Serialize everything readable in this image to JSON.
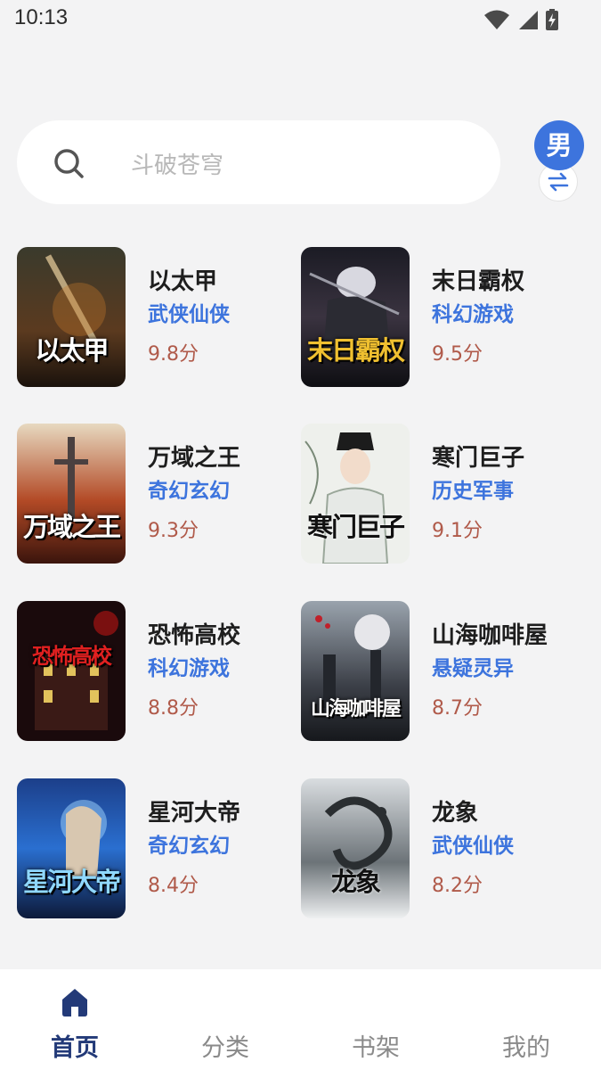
{
  "status": {
    "time": "10:13"
  },
  "search": {
    "placeholder": "斗破苍穹"
  },
  "gender": {
    "label": "男"
  },
  "books": [
    {
      "title": "以太甲",
      "genre": "武侠仙侠",
      "score": "9.8分",
      "cover_text": "以太甲"
    },
    {
      "title": "末日霸权",
      "genre": "科幻游戏",
      "score": "9.5分",
      "cover_text": "末日霸权"
    },
    {
      "title": "万域之王",
      "genre": "奇幻玄幻",
      "score": "9.3分",
      "cover_text": "万域之王"
    },
    {
      "title": "寒门巨子",
      "genre": "历史军事",
      "score": "9.1分",
      "cover_text": "寒门巨子"
    },
    {
      "title": "恐怖高校",
      "genre": "科幻游戏",
      "score": "8.8分",
      "cover_text": "恐怖高校"
    },
    {
      "title": "山海咖啡屋",
      "genre": "悬疑灵异",
      "score": "8.7分",
      "cover_text": "山海咖啡屋"
    },
    {
      "title": "星河大帝",
      "genre": "奇幻玄幻",
      "score": "8.4分",
      "cover_text": "星河大帝"
    },
    {
      "title": "龙象",
      "genre": "武侠仙侠",
      "score": "8.2分",
      "cover_text": "龙象"
    }
  ],
  "nav": [
    {
      "label": "首页",
      "icon": "home-icon",
      "active": true
    },
    {
      "label": "分类",
      "active": false
    },
    {
      "label": "书架",
      "active": false
    },
    {
      "label": "我的",
      "active": false
    }
  ],
  "colors": {
    "accent": "#3d74dd",
    "score": "#b05a4a",
    "nav_active": "#233a78"
  }
}
